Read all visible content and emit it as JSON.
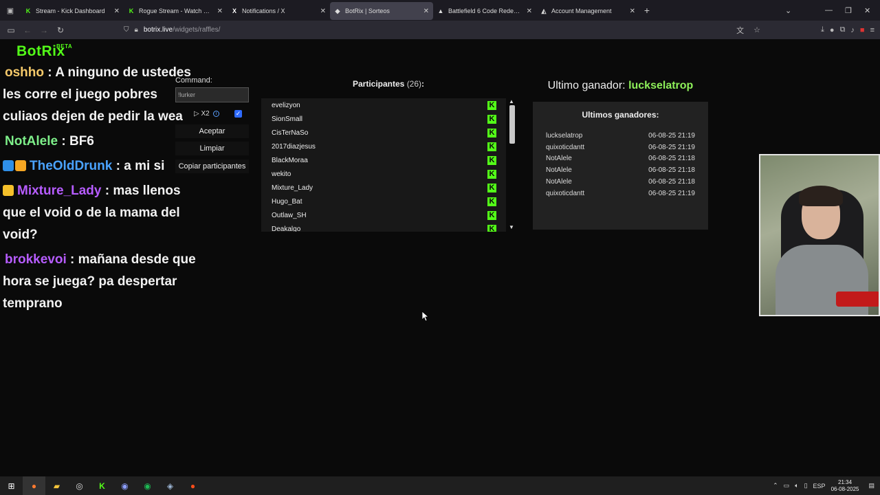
{
  "browser": {
    "tabs": [
      {
        "label": "Stream - Kick Dashboard",
        "icon": "kick-icon",
        "active": false
      },
      {
        "label": "Rogue Stream - Watch Live on K",
        "icon": "kick-icon",
        "active": false
      },
      {
        "label": "Notifications / X",
        "icon": "x-icon",
        "active": false
      },
      {
        "label": "BotRix | Sorteos",
        "icon": "botrix-icon",
        "active": true
      },
      {
        "label": "Battlefield 6 Code Redemption",
        "icon": "battlefield-icon",
        "active": false
      },
      {
        "label": "Account Management",
        "icon": "ea-icon",
        "active": false
      }
    ],
    "url_host": "botrix.live",
    "url_path": "/widgets/raffles/"
  },
  "brand": {
    "name": "BotRix",
    "tag": "BETA",
    "color": "#53fc18"
  },
  "chat": [
    {
      "user": "oshho",
      "color": "#f5c96a",
      "badges": [],
      "text": "A ninguno de ustedes les corre el juego pobres culiaos dejen de pedir la wea"
    },
    {
      "user": "NotAlele",
      "color": "#7ef08a",
      "badges": [],
      "text": "BF6"
    },
    {
      "user": "TheOldDrunk",
      "color": "#4aa3ff",
      "badges": [
        "#2f8fe8",
        "#f5a623"
      ],
      "text": "a mi si"
    },
    {
      "user": "Mixture_Lady",
      "color": "#b65cff",
      "badges": [
        "#f5c02a"
      ],
      "text": "mas llenos que el void o de la mama del void?"
    },
    {
      "user": "brokkevoi",
      "color": "#b65cff",
      "badges": [],
      "text": "mañana desde que hora se juega? pa despertar temprano"
    }
  ],
  "raffle": {
    "command_label": "Command:",
    "command_value": "!lurker",
    "sub_label": "X2",
    "sub_checked": true,
    "accept_label": "Aceptar",
    "clear_label": "Limpiar",
    "copy_label": "Copiar participantes"
  },
  "participants": {
    "title": "Participantes",
    "count": "(26)",
    "suffix": ":",
    "names": [
      "evelizyon",
      "SionSmall",
      "CisTerNaSo",
      "2017diazjesus",
      "BlackMoraa",
      "wekito",
      "Mixture_Lady",
      "Hugo_Bat",
      "Outlaw_SH",
      "Deakalgo"
    ]
  },
  "winners": {
    "last_label": "Ultimo ganador:",
    "last_name": "luckselatrop",
    "list_title": "Ultimos ganadores:",
    "list": [
      {
        "name": "luckselatrop",
        "date": "06-08-25 21:19"
      },
      {
        "name": "quixoticdantt",
        "date": "06-08-25 21:19"
      },
      {
        "name": "NotAlele",
        "date": "06-08-25 21:18"
      },
      {
        "name": "NotAlele",
        "date": "06-08-25 21:18"
      },
      {
        "name": "NotAlele",
        "date": "06-08-25 21:18"
      },
      {
        "name": "quixoticdantt",
        "date": "06-08-25 21:19"
      }
    ]
  },
  "taskbar": {
    "lang": "ESP",
    "time": "21:34",
    "date": "06-08-2025"
  }
}
